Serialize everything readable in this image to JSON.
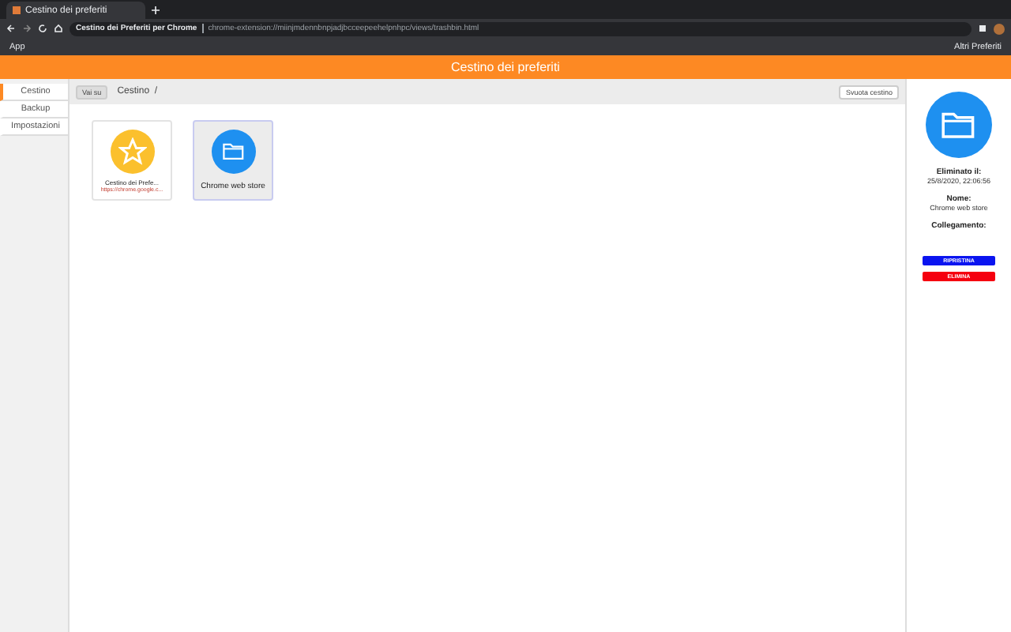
{
  "browser": {
    "tab_title": "Cestino dei preferiti",
    "site_name": "Cestino dei Preferiti per Chrome",
    "url": "chrome-extension://miinjmdennbnpjadjbcceepeehelpnhpc/views/trashbin.html",
    "bookmarks": [
      {
        "label": "App"
      }
    ],
    "other_bookmarks": "Altri Preferiti"
  },
  "header": {
    "title": "Cestino dei preferiti"
  },
  "sidebar": {
    "items": [
      {
        "label": "Cestino",
        "selected": true
      },
      {
        "label": "Backup",
        "selected": false
      },
      {
        "label": "Impostazioni",
        "selected": false
      }
    ]
  },
  "toolbar": {
    "back_button": "Vai su",
    "path": "Cestino  /",
    "empty_button": "Svuota cestino"
  },
  "items": [
    {
      "kind": "bookmark",
      "title": "Cestino dei Prefe...",
      "url": "https://chrome.google.c...",
      "selected": false
    },
    {
      "kind": "folder",
      "title": "Chrome web store",
      "selected": true
    }
  ],
  "details": {
    "deleted_label": "Eliminato il:",
    "deleted_value": "25/8/2020, 22:06:56",
    "name_label": "Nome:",
    "name_value": "Chrome web store",
    "link_label": "Collegamento:",
    "restore_button": "RIPRISTINA",
    "delete_button": "ELIMINA"
  }
}
